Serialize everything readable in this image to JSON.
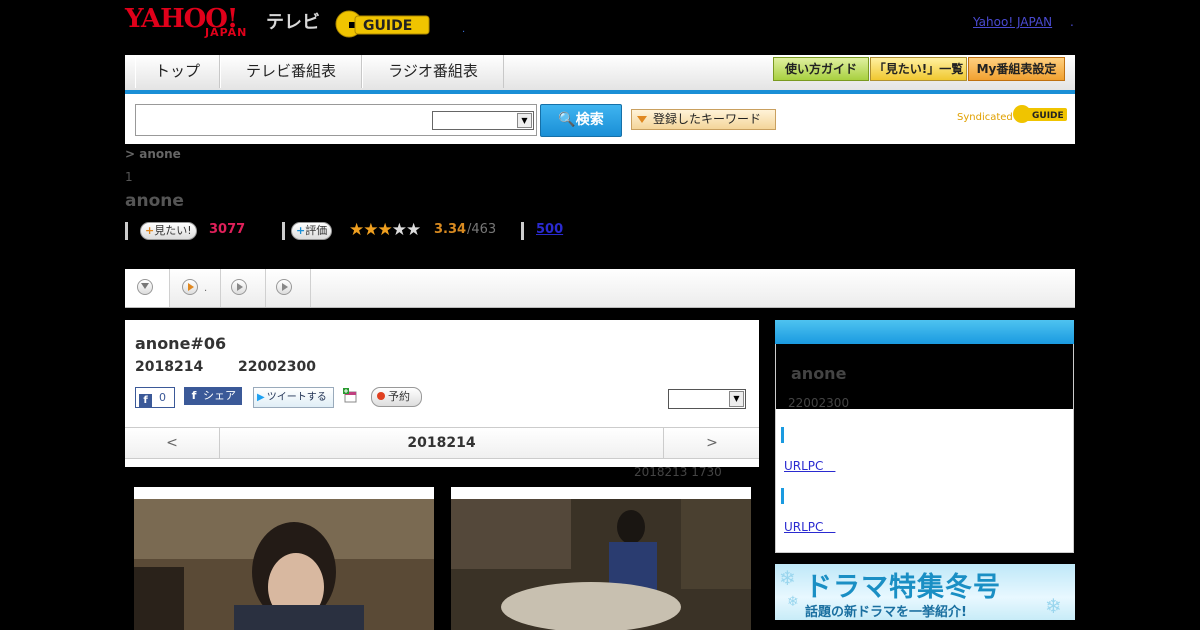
{
  "header": {
    "logo_yahoo": "YAHOO!",
    "logo_japan": "JAPAN",
    "logo_tv": "テレビ",
    "logo_gguide": "G-GUIDE",
    "dot": ".",
    "yahoo_japan_link": "Yahoo! JAPAN",
    "dot2": "."
  },
  "nav": {
    "tabs": [
      "トップ",
      "テレビ番組表",
      "ラジオ番組表"
    ],
    "buttons": [
      "使い方ガイド",
      "「見たい!」一覧",
      "My番組表設定"
    ],
    "accent": "#1a8fd6"
  },
  "search": {
    "placeholder": "",
    "select_value": "",
    "button_label": "検索",
    "keyword_button": "登録したキーワード",
    "syndicated": "Syndicated",
    "gguide": "GUIDE"
  },
  "program": {
    "breadcrumb": " > anone",
    "number": "1",
    "title": "anone",
    "want_label": "見たい!",
    "want_count": "3077",
    "rate_label": "評価",
    "stars": "★★★★★",
    "rating": 3.34,
    "rating_text": "3.34",
    "rating_count": "/463",
    "reviews_link": "500"
  },
  "episode": {
    "title": "anone#06",
    "date": "2018214",
    "time": "22002300",
    "fb_count": "0",
    "fb_share": "シェア",
    "tweet": "ツイートする",
    "reserve": "予約",
    "select_value": "",
    "pager_prev": "<",
    "pager_date": "2018214",
    "pager_next": ">",
    "updated": "2018213  1730"
  },
  "sidebar": {
    "title": "anone",
    "time": "22002300",
    "link1": "URLPC　",
    "link2": "URLPC　"
  },
  "banner": {
    "line1": "ドラマ特集冬号",
    "line2": "話題の新ドラマを一挙紹介!"
  }
}
